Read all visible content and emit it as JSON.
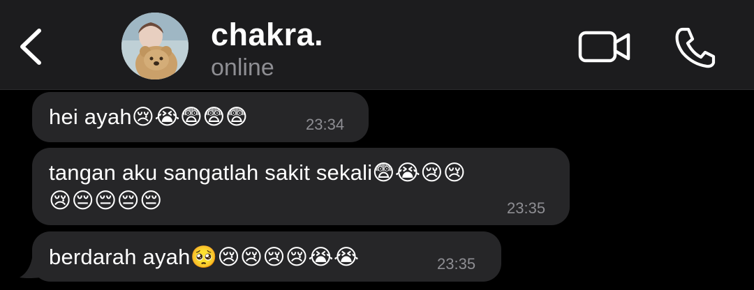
{
  "header": {
    "title": "chakra.",
    "status": "online"
  },
  "messages": [
    {
      "text": "hei ayah😢😭😨😨😨",
      "time": "23:34"
    },
    {
      "line1": "tangan aku sangatlah sakit sekali😨😭😢😢",
      "line2": "😢😔😔😔😔",
      "time": "23:35"
    },
    {
      "text": "berdarah ayah🥺😢😢😢😢😭😭",
      "time": "23:35"
    }
  ],
  "colors": {
    "header_bg": "#1c1c1e",
    "bubble_bg": "#262628",
    "time_text": "#8e8e93"
  }
}
